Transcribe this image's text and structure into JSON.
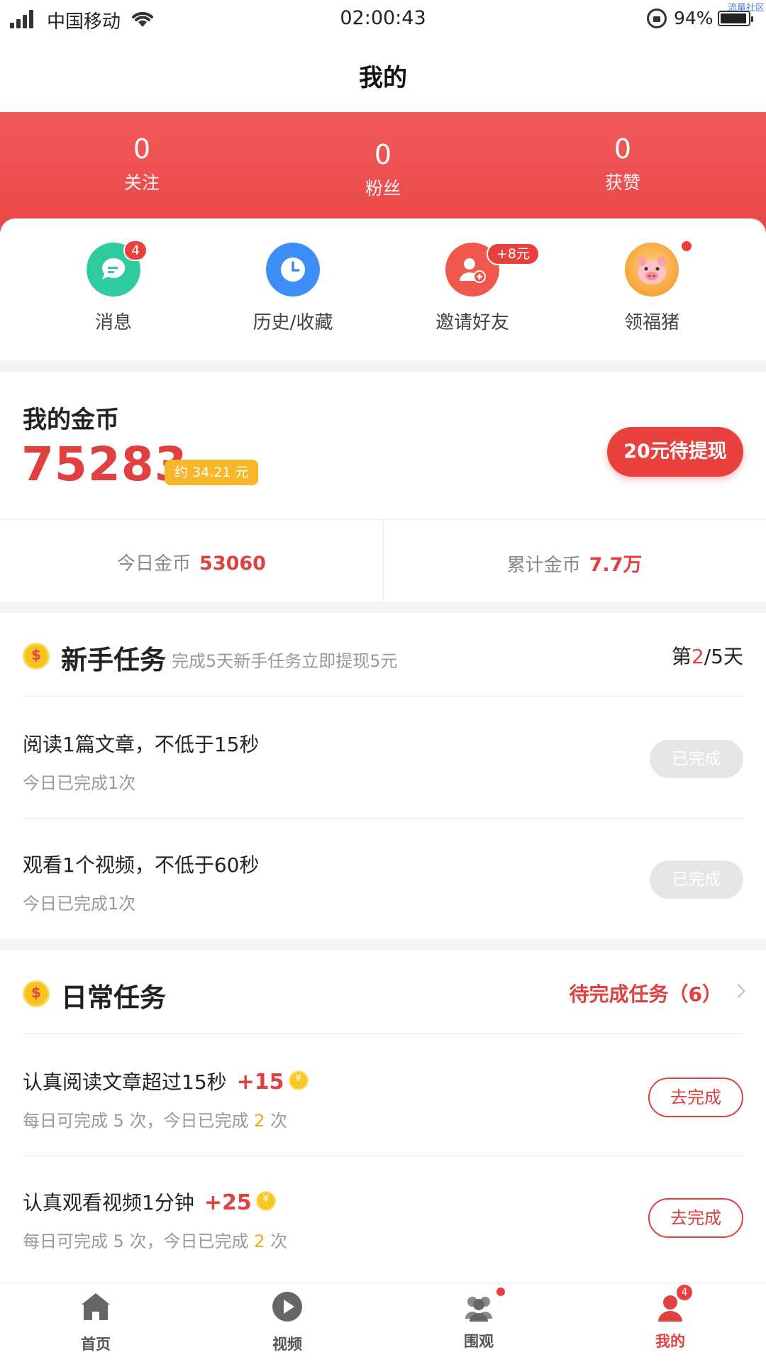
{
  "status_bar": {
    "carrier": "中国移动",
    "time": "02:00:43",
    "battery": "94%",
    "watermark": "流量社区"
  },
  "nav": {
    "title": "我的"
  },
  "stats": [
    {
      "value": "0",
      "label": "关注"
    },
    {
      "value": "0",
      "label": "粉丝"
    },
    {
      "value": "0",
      "label": "获赞"
    }
  ],
  "quick_actions": [
    {
      "label": "消息",
      "badge": "4",
      "icon": "message-icon",
      "color": "#2ecba0"
    },
    {
      "label": "历史/收藏",
      "icon": "clock-icon",
      "color": "#3e8ef7"
    },
    {
      "label": "邀请好友",
      "badge": "+8元",
      "icon": "add-user-icon",
      "color": "#f0584e"
    },
    {
      "label": "领福猪",
      "icon": "pig-icon",
      "color": "#f7a43a"
    }
  ],
  "coins": {
    "title": "我的金币",
    "amount": "75283",
    "approx": "约 34.21 元",
    "withdraw_label": "20元待提现",
    "today_label": "今日金币",
    "today_value": "53060",
    "total_label": "累计金币",
    "total_value": "7.7万"
  },
  "newbie": {
    "title": "新手任务",
    "subtitle": "完成5天新手任务立即提现5元",
    "progress_prefix": "第",
    "progress_current": "2",
    "progress_suffix": "/5天",
    "tasks": [
      {
        "name": "阅读1篇文章，不低于15秒",
        "sub": "今日已完成1次",
        "button": "已完成"
      },
      {
        "name": "观看1个视频，不低于60秒",
        "sub": "今日已完成1次",
        "button": "已完成"
      }
    ]
  },
  "daily": {
    "title": "日常任务",
    "pending_label": "待完成任务（6）",
    "tasks": [
      {
        "name": "认真阅读文章超过15秒",
        "reward": "+15",
        "sub_prefix": "每日可完成 5 次，今日已完成 ",
        "sub_count": "2",
        "sub_suffix": " 次",
        "button": "去完成"
      },
      {
        "name": "认真观看视频1分钟",
        "reward": "+25",
        "sub_prefix": "每日可完成 5 次，今日已完成 ",
        "sub_count": "2",
        "sub_suffix": " 次",
        "button": "去完成"
      }
    ]
  },
  "tabbar": [
    {
      "label": "首页",
      "icon": "home-icon"
    },
    {
      "label": "视频",
      "icon": "play-icon"
    },
    {
      "label": "围观",
      "icon": "group-icon"
    },
    {
      "label": "我的",
      "icon": "profile-icon",
      "badge": "4"
    }
  ],
  "colors": {
    "accent": "#e04040",
    "header_red": "#f05a5a",
    "gold": "#f8b62a"
  }
}
